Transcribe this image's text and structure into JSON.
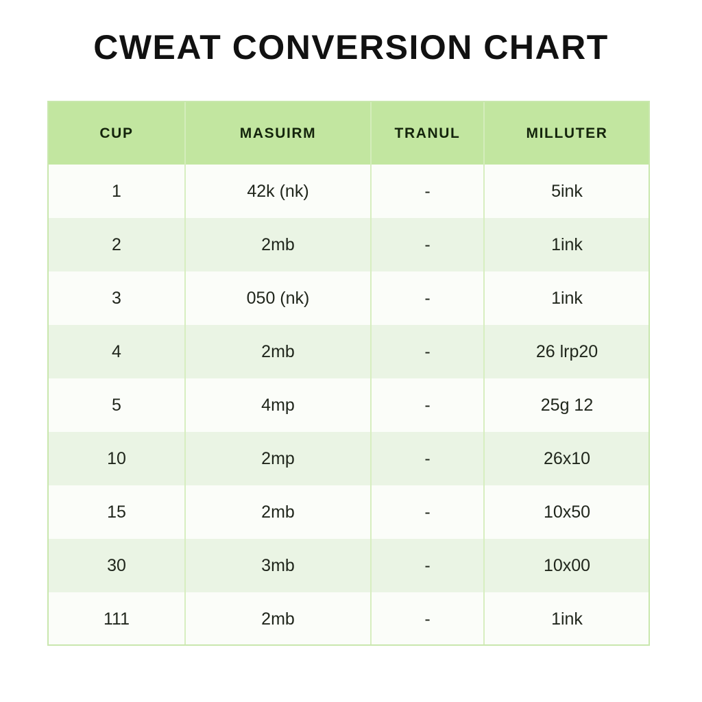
{
  "page": {
    "title": "CWEAT CONVERSION CHART",
    "background_color": "#ffffff"
  },
  "colors": {
    "header_background": "#c2e6a0",
    "header_text": "#14240c",
    "row_odd_background": "#fbfdf9",
    "row_even_background": "#eaf4e4",
    "grid_line": "#d7eec0",
    "table_border": "#c9e7ae",
    "body_text": "#20261c",
    "title_text": "#111111"
  },
  "chart_data": {
    "type": "table",
    "title": "CWEAT CONVERSION CHART",
    "columns": [
      "CUP",
      "MASUIRM",
      "TRANUL",
      "MILLUTER"
    ],
    "rows": [
      [
        "1",
        "42k (nk)",
        "-",
        "5ink"
      ],
      [
        "2",
        "2mb",
        "-",
        "1ink"
      ],
      [
        "3",
        "050 (nk)",
        "-",
        "1ink"
      ],
      [
        "4",
        "2mb",
        "-",
        "26 lrp20"
      ],
      [
        "5",
        "4mp",
        "-",
        "25g 12"
      ],
      [
        "10",
        "2mp",
        "-",
        "26x10"
      ],
      [
        "15",
        "2mb",
        "-",
        "10x50"
      ],
      [
        "30",
        "3mb",
        "-",
        "10x00"
      ],
      [
        "111",
        "2mb",
        "-",
        "1ink"
      ]
    ]
  }
}
